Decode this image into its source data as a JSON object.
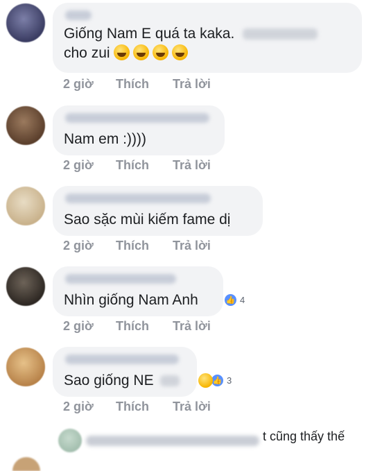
{
  "comments": [
    {
      "text": "Giống Nam E quá ta kaka.",
      "text_line2": "cho zui",
      "emojis": [
        "laughing-tears-emoji",
        "laughing-tears-emoji",
        "laughing-tears-emoji",
        "laughing-tears-emoji"
      ],
      "time": "2 giờ",
      "like": "Thích",
      "reply": "Trả lời"
    },
    {
      "text": "Nam em :))))",
      "time": "2 giờ",
      "like": "Thích",
      "reply": "Trả lời"
    },
    {
      "text": "Sao sặc mùi kiếm fame dị",
      "time": "2 giờ",
      "like": "Thích",
      "reply": "Trả lời"
    },
    {
      "text": "Nhìn giống Nam Anh",
      "reaction_count": "4",
      "reaction_icons": [
        "like-icon"
      ],
      "time": "2 giờ",
      "like": "Thích",
      "reply": "Trả lời"
    },
    {
      "text": "Sao giống NE",
      "reaction_count": "3",
      "reaction_icons": [
        "laugh-icon",
        "like-icon"
      ],
      "time": "2 giờ",
      "like": "Thích",
      "reply": "Trả lời"
    }
  ],
  "reply_preview": {
    "text": "t cũng thấy thế"
  },
  "colors": {
    "bubble_bg": "#f2f3f5",
    "meta_text": "#90949c",
    "like_blue": "#5890ff",
    "text": "#1c1e21"
  }
}
